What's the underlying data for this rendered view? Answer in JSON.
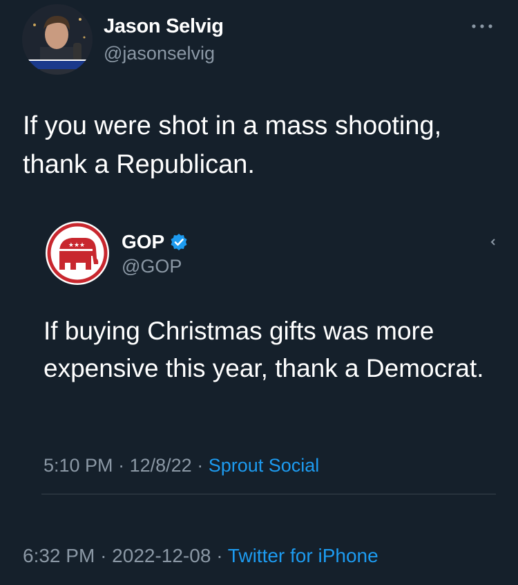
{
  "tweet": {
    "author": {
      "name": "Jason Selvig",
      "handle": "@jasonselvig",
      "avatar_caption": "JASON SELVIG"
    },
    "text": "If you were shot in a mass shooting, thank a Republican.",
    "time": "6:32 PM",
    "date": "2022-12-08",
    "separator": "·",
    "source": "Twitter for iPhone"
  },
  "quoted_tweet": {
    "author": {
      "name": "GOP",
      "handle": "@GOP",
      "verified": true
    },
    "text": "If buying Christmas gifts was more expensive this year, thank a Democrat.",
    "time": "5:10 PM",
    "date": "12/8/22",
    "separator": "·",
    "source": "Sprout Social"
  },
  "icons": {
    "more": "more-horizontal-icon",
    "verified": "verified-badge-icon",
    "logo": "gop-elephant-logo"
  },
  "colors": {
    "background": "#15202b",
    "text": "#ffffff",
    "secondary_text": "#8b98a5",
    "link": "#1d9bf0",
    "divider": "#38444d",
    "gop_red": "#c8272e"
  }
}
